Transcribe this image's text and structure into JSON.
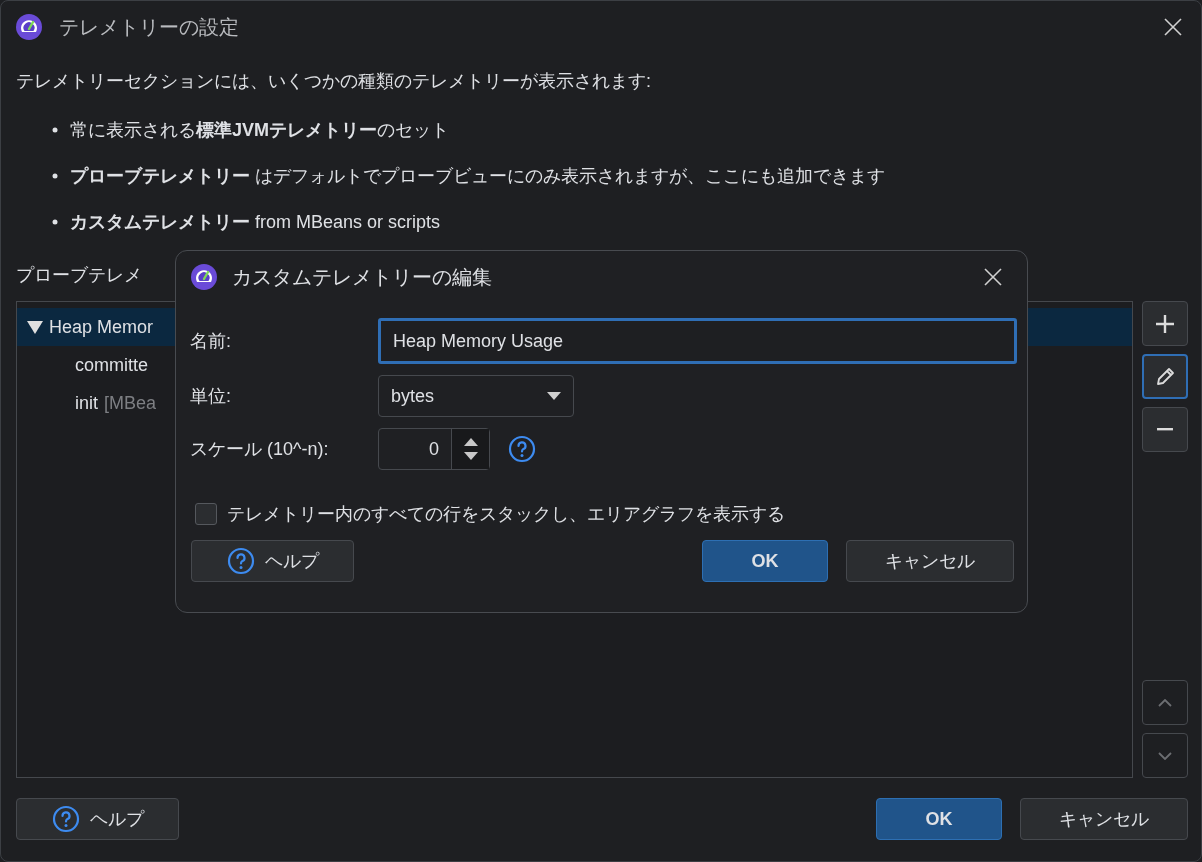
{
  "window": {
    "title": "テレメトリーの設定"
  },
  "intro": "テレメトリーセクションには、いくつかの種類のテレメトリーが表示されます:",
  "bullets": [
    "常に表示される**標準JVMテレメトリー**のセット",
    "**プローブテレメトリー** はデフォルトでプローブビューにのみ表示されますが、ここにも追加できます",
    "**カスタムテレメトリー** from MBeans or scripts"
  ],
  "list_label": "プローブテレメ",
  "tree": [
    {
      "label": "Heap Memor",
      "expanded": true,
      "selected": true,
      "children": [
        {
          "label": "committe",
          "selected": false
        },
        {
          "label": "init",
          "detail": "[MBea",
          "selected": false
        }
      ]
    }
  ],
  "side_buttons": [
    {
      "kind": "add",
      "disabled": false,
      "selected": false
    },
    {
      "kind": "edit",
      "disabled": false,
      "selected": true
    },
    {
      "kind": "remove",
      "disabled": false,
      "selected": false
    },
    {
      "kind": "up",
      "disabled": true,
      "selected": false
    },
    {
      "kind": "down",
      "disabled": true,
      "selected": false
    }
  ],
  "footer": {
    "help": "ヘルプ",
    "ok": "OK",
    "cancel": "キャンセル"
  },
  "dialog": {
    "title": "カスタムテレメトリーの編集",
    "name_label": "名前:",
    "name_value": "Heap Memory Usage",
    "unit_label": "単位:",
    "unit_value": "bytes",
    "scale_label": "スケール (10^-n):",
    "scale_value": "0",
    "stack_checkbox": {
      "label": "テレメトリー内のすべての行をスタックし、エリアグラフを表示する",
      "checked": false
    },
    "help": "ヘルプ",
    "ok": "OK",
    "cancel": "キャンセル"
  }
}
